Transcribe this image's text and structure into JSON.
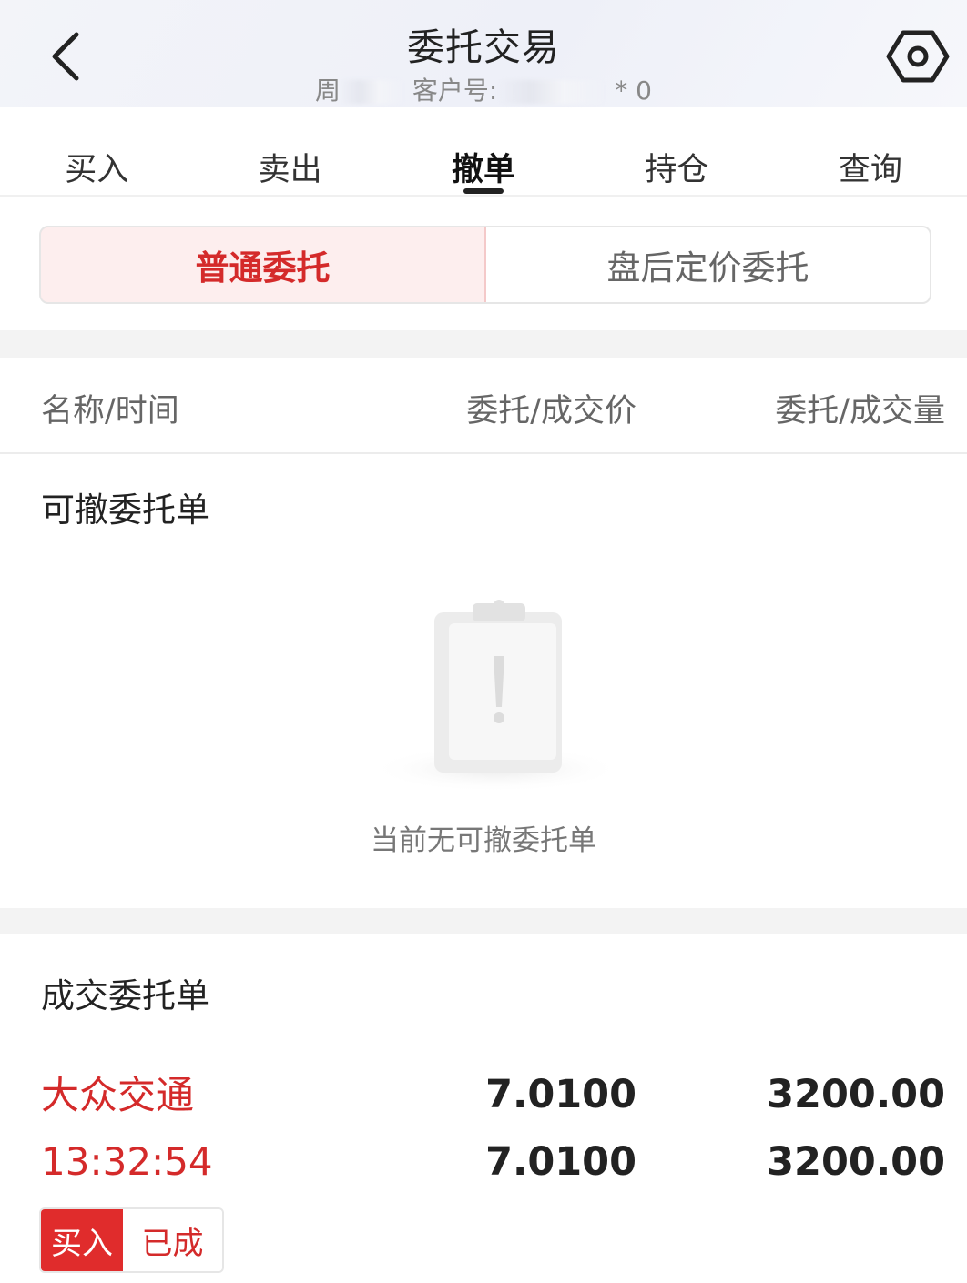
{
  "header": {
    "title": "委托交易",
    "subtitle_prefix": "周",
    "subtitle_label": "客户号:",
    "subtitle_tail": "*  0"
  },
  "tabs": [
    {
      "label": "买入"
    },
    {
      "label": "卖出"
    },
    {
      "label": "撤单"
    },
    {
      "label": "持仓"
    },
    {
      "label": "查询"
    }
  ],
  "segment": {
    "normal": "普通委托",
    "after_hours": "盘后定价委托"
  },
  "columns": {
    "name_time": "名称/时间",
    "price": "委托/成交价",
    "volume": "委托/成交量"
  },
  "cancelable": {
    "title": "可撤委托单",
    "empty_text": "当前无可撤委托单"
  },
  "filled": {
    "title": "成交委托单",
    "orders": [
      {
        "name": "大众交通",
        "time": "13:32:54",
        "order_price": "7.0100",
        "deal_price": "7.0100",
        "order_volume": "3200.00",
        "deal_volume": "3200.00",
        "side": "买入",
        "status": "已成"
      }
    ]
  },
  "colors": {
    "accent_red": "#d42a2a",
    "badge_red": "#e02c2c",
    "segment_active_bg": "#fdeeee"
  },
  "icons": {
    "back": "chevron-left-icon",
    "settings": "hexagon-settings-icon",
    "empty": "clipboard-warning-icon"
  }
}
